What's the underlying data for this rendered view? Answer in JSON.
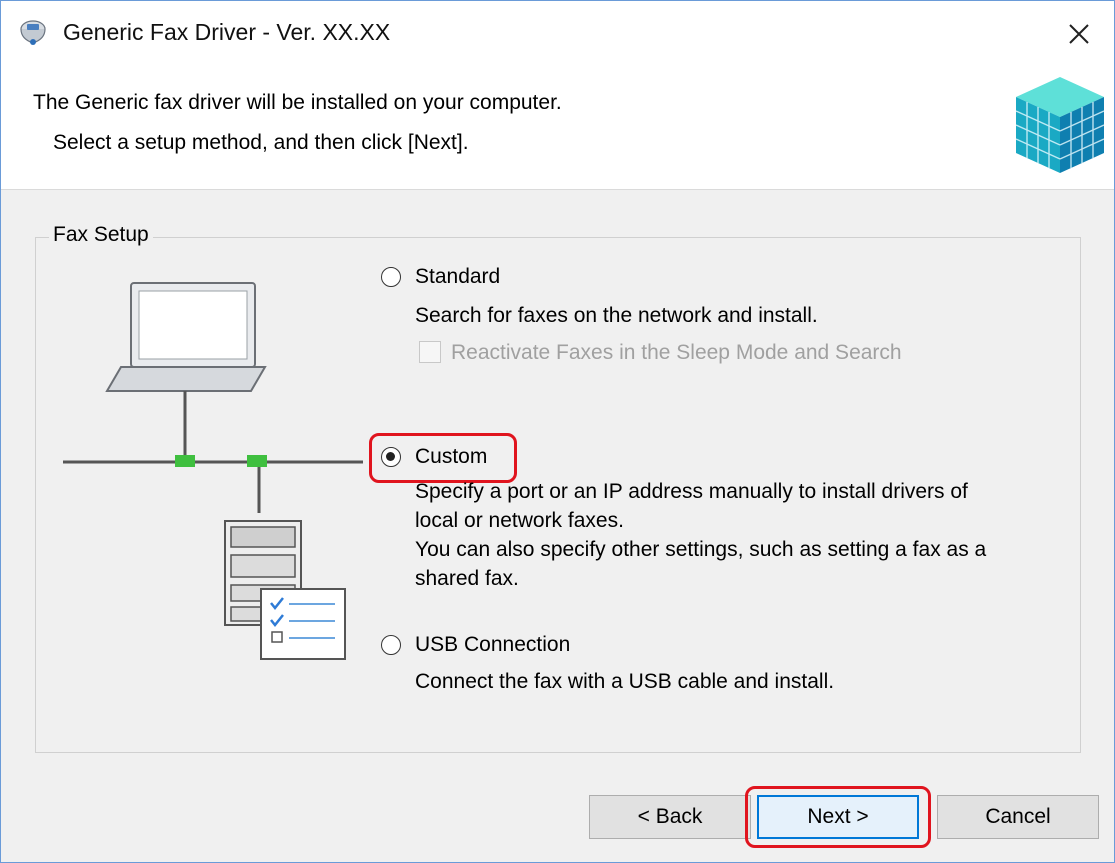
{
  "window": {
    "title": "Generic Fax Driver - Ver. XX.XX"
  },
  "header": {
    "line1": "The Generic fax driver will be installed on your computer.",
    "line2": "Select a setup method, and then click [Next]."
  },
  "fax_setup": {
    "group_label": "Fax Setup",
    "options": [
      {
        "label": "Standard",
        "selected": false,
        "description": [
          "Search for faxes on the network and install."
        ],
        "checkbox": {
          "label": "Reactivate Faxes in the Sleep Mode and Search",
          "checked": false,
          "disabled": true
        }
      },
      {
        "label": "Custom",
        "selected": true,
        "description": [
          "Specify a port or an IP address manually to install drivers of",
          "local or network faxes.",
          "You can also specify other settings, such as setting a fax as a",
          "shared fax."
        ]
      },
      {
        "label": "USB Connection",
        "selected": false,
        "description": [
          "Connect the fax with a USB cable and install."
        ]
      }
    ]
  },
  "buttons": {
    "back": "< Back",
    "next": "Next >",
    "cancel": "Cancel"
  },
  "colors": {
    "highlight": "#e0141e",
    "default_button_border": "#0078d7",
    "network_port": "#3fbf3f"
  },
  "icons": [
    "fax-driver-app-icon",
    "close-icon",
    "installer-cube-icon",
    "laptop-icon",
    "printer-icon",
    "checklist-icon"
  ]
}
